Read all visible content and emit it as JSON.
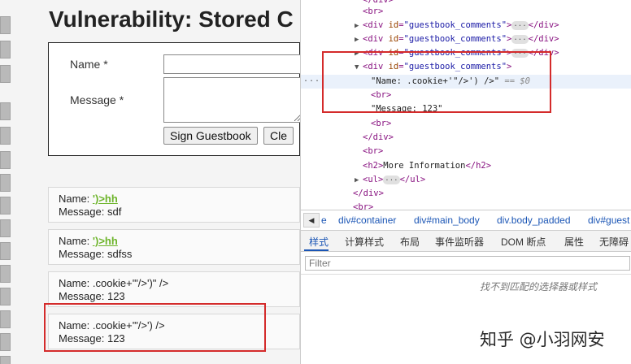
{
  "page": {
    "title": "Vulnerability: Stored C",
    "form": {
      "name_label": "Name *",
      "message_label": "Message *",
      "sign_button": "Sign Guestbook",
      "clear_button": "Cle"
    },
    "comments": [
      {
        "name_prefix": "Name: ",
        "name_value": "')>hh",
        "message": "Message: sdf"
      },
      {
        "name_prefix": "Name: ",
        "name_value": "')>hh",
        "message": "Message: sdfss"
      },
      {
        "name_prefix": "Name: ",
        "name_value": ".cookie+'\"/>')\" />",
        "message": "Message: 123"
      },
      {
        "name_prefix": "Name: ",
        "name_value": ".cookie+'\"/>') />",
        "message": "Message: 123"
      }
    ]
  },
  "devtools": {
    "dom_lines": [
      "<br>",
      "<div id=\"guestbook_comments\">",
      "</div>",
      "\"Name: .cookie+'\"/>') />\"",
      "== $0",
      "<br>",
      "\"Message: 123\"",
      "</div>",
      "More Information",
      "<ul>",
      "</ul>",
      "</div>",
      "<h2>",
      "</h2>"
    ],
    "attr_name": "id",
    "attr_value": "\"guestbook_comments\"",
    "row_dots": "...",
    "ellipsis": "...",
    "breadcrumbs": [
      "e",
      "div#container",
      "div#main_body",
      "div.body_padded",
      "div#guest"
    ],
    "tabs": [
      "样式",
      "计算样式",
      "布局",
      "事件监听器",
      "DOM 断点",
      "属性",
      "无障碍"
    ],
    "filter_placeholder": "Filter",
    "no_match_text": "找不到匹配的选择器或样式"
  },
  "watermark": "知乎 @小羽网安",
  "colors": {
    "highlight_red": "#d42b2b",
    "link_green": "#6db42a",
    "devtools_blue": "#1a55b5"
  }
}
